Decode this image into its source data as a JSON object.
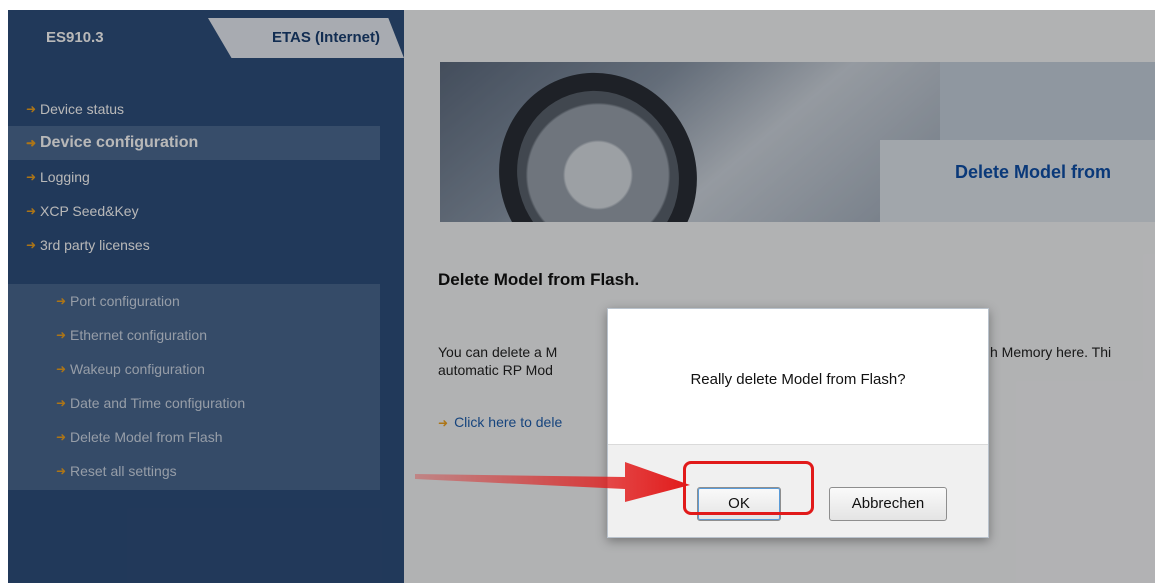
{
  "header": {
    "tabs": [
      {
        "label": "ES910.3",
        "active": true
      },
      {
        "label": "ETAS (Internet)",
        "active": false
      }
    ]
  },
  "sidebar": {
    "items": [
      {
        "label": "Device status",
        "active": false
      },
      {
        "label": "Device configuration",
        "active": true
      },
      {
        "label": "Logging",
        "active": false
      },
      {
        "label": "XCP Seed&Key",
        "active": false
      },
      {
        "label": "3rd party licenses",
        "active": false
      }
    ],
    "subitems": [
      {
        "label": "Port configuration"
      },
      {
        "label": "Ethernet configuration"
      },
      {
        "label": "Wakeup configuration"
      },
      {
        "label": "Date and Time configuration"
      },
      {
        "label": "Delete Model from Flash"
      },
      {
        "label": "Reset all settings"
      }
    ]
  },
  "main": {
    "banner_title": "Delete Model from",
    "heading": "Delete Model from Flash.",
    "paragraph_line1_left": "You can delete a M",
    "paragraph_line1_right": "h Memory here. Thi",
    "paragraph_line2_left": "automatic RP Mod",
    "link_text": "Click here to dele"
  },
  "dialog": {
    "message": "Really delete Model from Flash?",
    "ok_label": "OK",
    "cancel_label": "Abbrechen"
  },
  "colors": {
    "sidebar_bg": "#2f4f7d",
    "accent_orange": "#f0a31f",
    "link_blue": "#1f5fae",
    "highlight_red": "#e11a1a"
  },
  "icons": {
    "nav_bullet": "arrow-right-icon",
    "annotation": "red-arrow-icon"
  }
}
